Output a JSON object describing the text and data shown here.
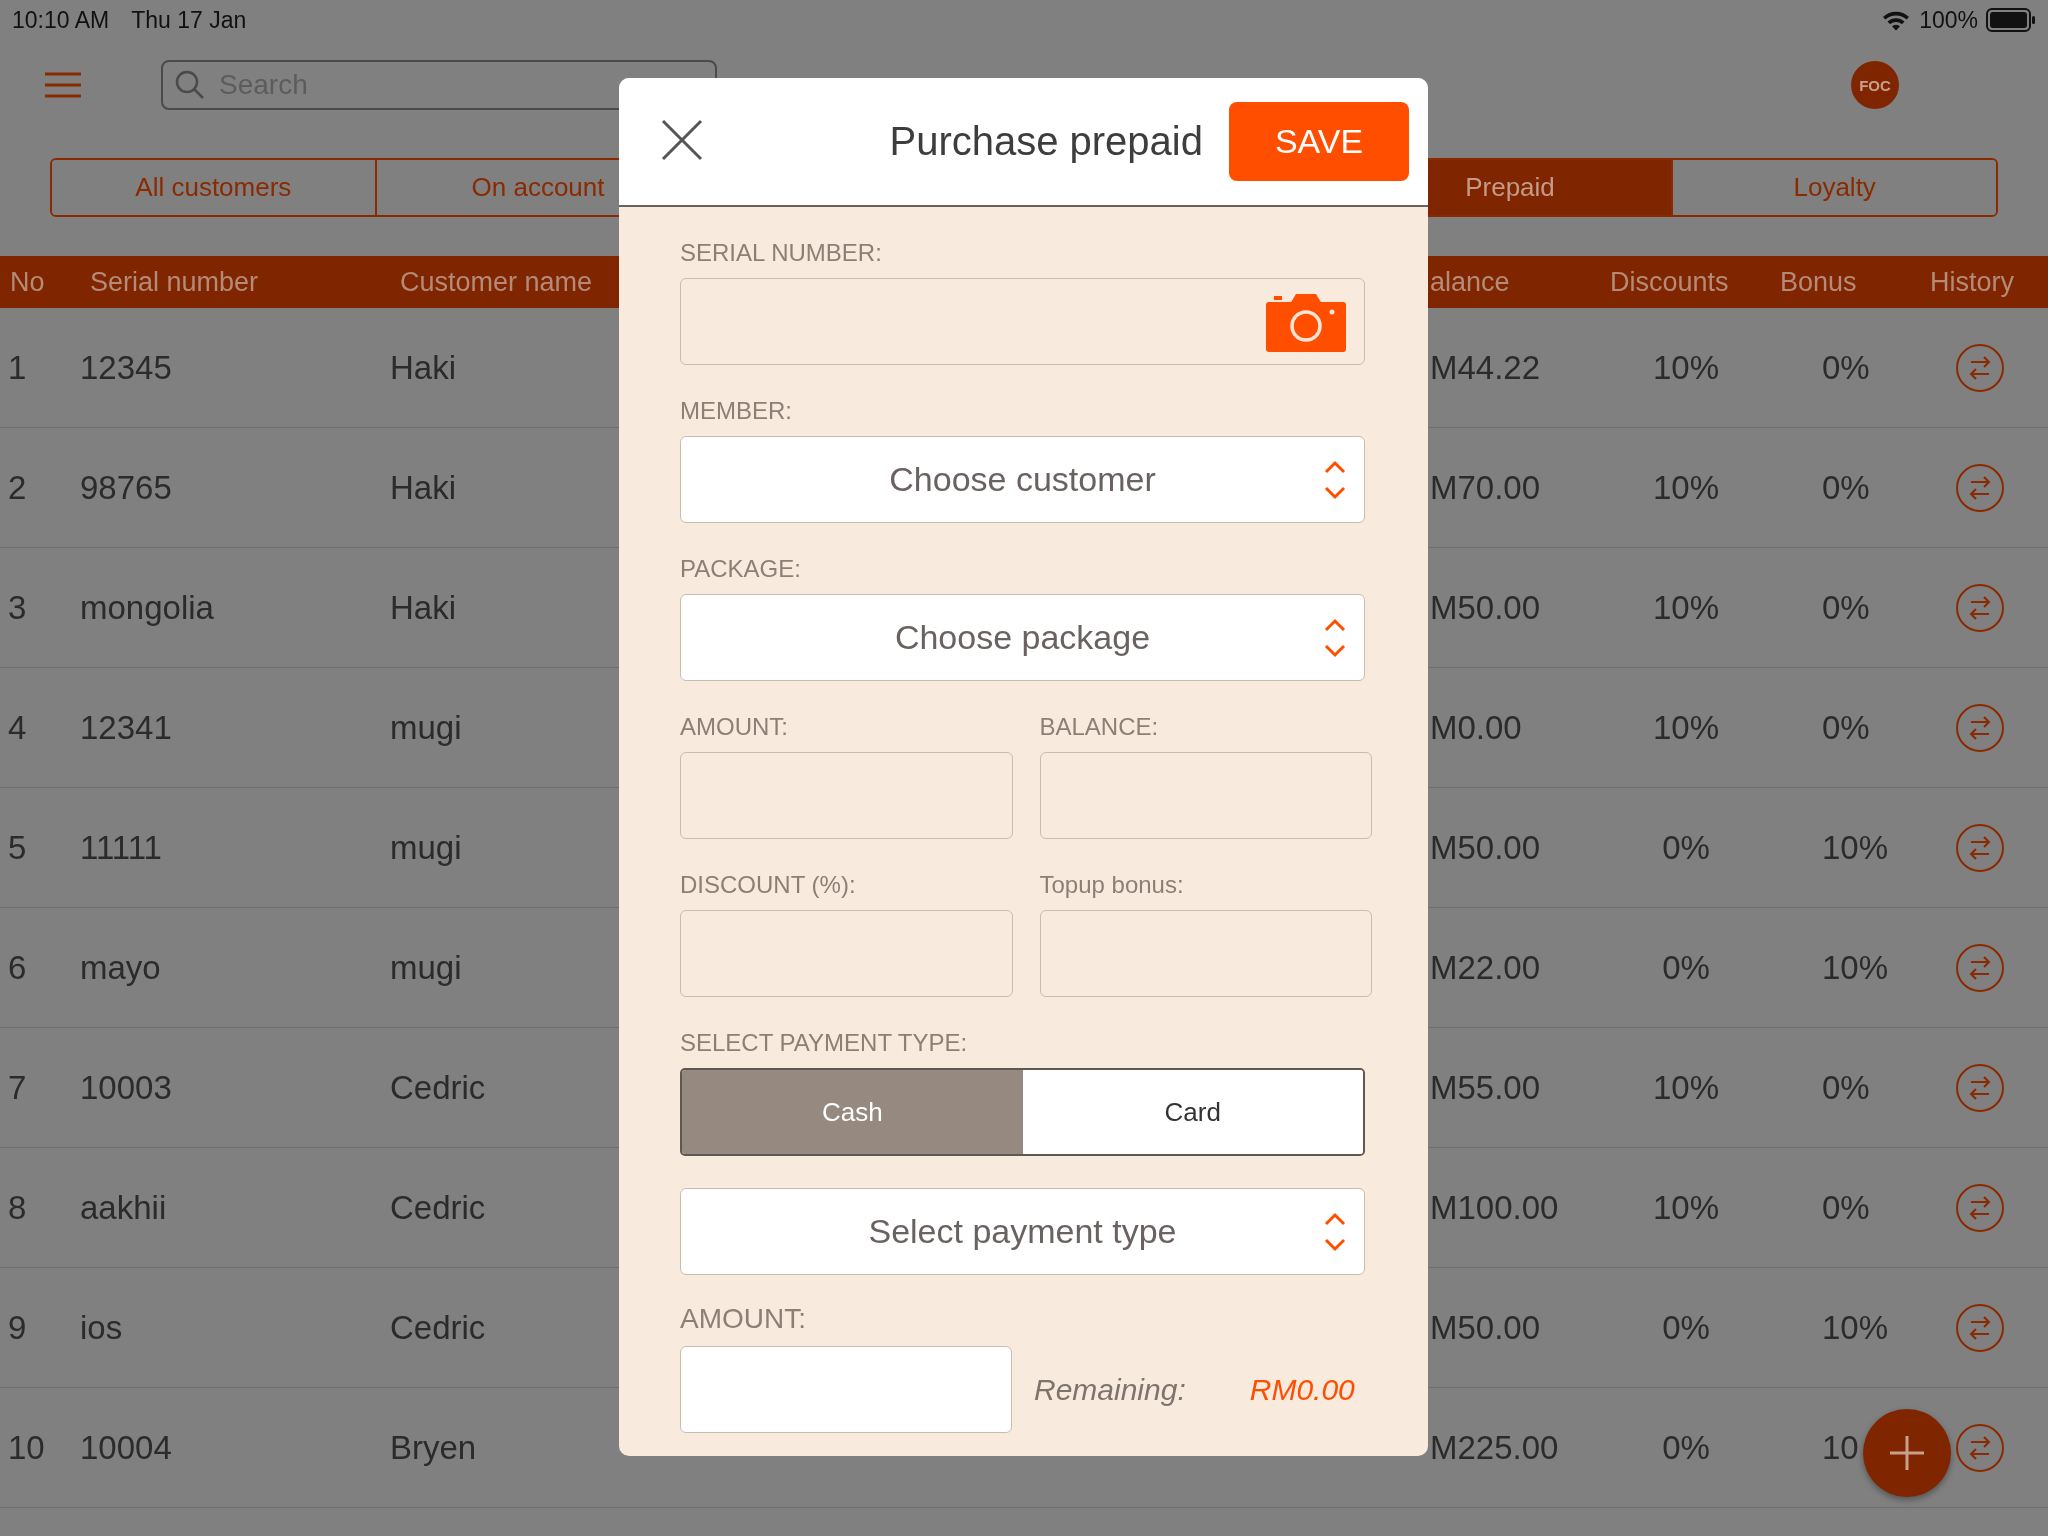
{
  "status_bar": {
    "time": "10:10 AM",
    "date": "Thu 17 Jan",
    "battery": "100%"
  },
  "nav": {
    "search": {
      "placeholder": "Search"
    },
    "avatar": "FOC"
  },
  "tabs": [
    {
      "label": "All customers",
      "selected": false
    },
    {
      "label": "On account",
      "selected": false
    },
    {
      "label": "Prepaid",
      "selected": true
    },
    {
      "label": "Loyalty",
      "selected": false
    }
  ],
  "table": {
    "columns": [
      "No",
      "Serial number",
      "Customer name",
      "alance",
      "Discounts",
      "Bonus",
      "History"
    ],
    "rows": [
      {
        "no": "1",
        "serial": "12345",
        "customer": "Haki",
        "balance": "M44.22",
        "discount": "10%",
        "bonus": "0%"
      },
      {
        "no": "2",
        "serial": "98765",
        "customer": "Haki",
        "balance": "M70.00",
        "discount": "10%",
        "bonus": "0%"
      },
      {
        "no": "3",
        "serial": "mongolia",
        "customer": "Haki",
        "balance": "M50.00",
        "discount": "10%",
        "bonus": "0%"
      },
      {
        "no": "4",
        "serial": "12341",
        "customer": "mugi",
        "balance": "M0.00",
        "discount": "10%",
        "bonus": "0%"
      },
      {
        "no": "5",
        "serial": "11111",
        "customer": "mugi",
        "balance": "M50.00",
        "discount": "0%",
        "bonus": "10%"
      },
      {
        "no": "6",
        "serial": "mayo",
        "customer": "mugi",
        "balance": "M22.00",
        "discount": "0%",
        "bonus": "10%"
      },
      {
        "no": "7",
        "serial": "10003",
        "customer": "Cedric",
        "balance": "M55.00",
        "discount": "10%",
        "bonus": "0%"
      },
      {
        "no": "8",
        "serial": "aakhii",
        "customer": "Cedric",
        "balance": "M100.00",
        "discount": "10%",
        "bonus": "0%"
      },
      {
        "no": "9",
        "serial": "ios",
        "customer": "Cedric",
        "balance": "M50.00",
        "discount": "0%",
        "bonus": "10%"
      },
      {
        "no": "10",
        "serial": "10004",
        "customer": "Bryen",
        "balance": "M225.00",
        "discount": "0%",
        "bonus": "10"
      }
    ]
  },
  "modal": {
    "title": "Purchase prepaid",
    "save_label": "SAVE",
    "serial_number": {
      "label": "SERIAL NUMBER:"
    },
    "member": {
      "label": "MEMBER:",
      "prompt": "Choose customer"
    },
    "package": {
      "label": "PACKAGE:",
      "prompt": "Choose package"
    },
    "amount": {
      "label": "AMOUNT:"
    },
    "balance": {
      "label": "BALANCE:"
    },
    "discount": {
      "label": "DISCOUNT (%):"
    },
    "topup_bonus": {
      "label": "Topup bonus:"
    },
    "payment_type": {
      "label": "SELECT PAYMENT TYPE:",
      "options": [
        {
          "label": "Cash",
          "selected": true
        },
        {
          "label": "Card",
          "selected": false
        }
      ],
      "prompt": "Select payment type"
    },
    "payment_amount": {
      "label": "AMOUNT:"
    },
    "remaining": {
      "label": "Remaining:",
      "value": "RM0.00"
    }
  }
}
